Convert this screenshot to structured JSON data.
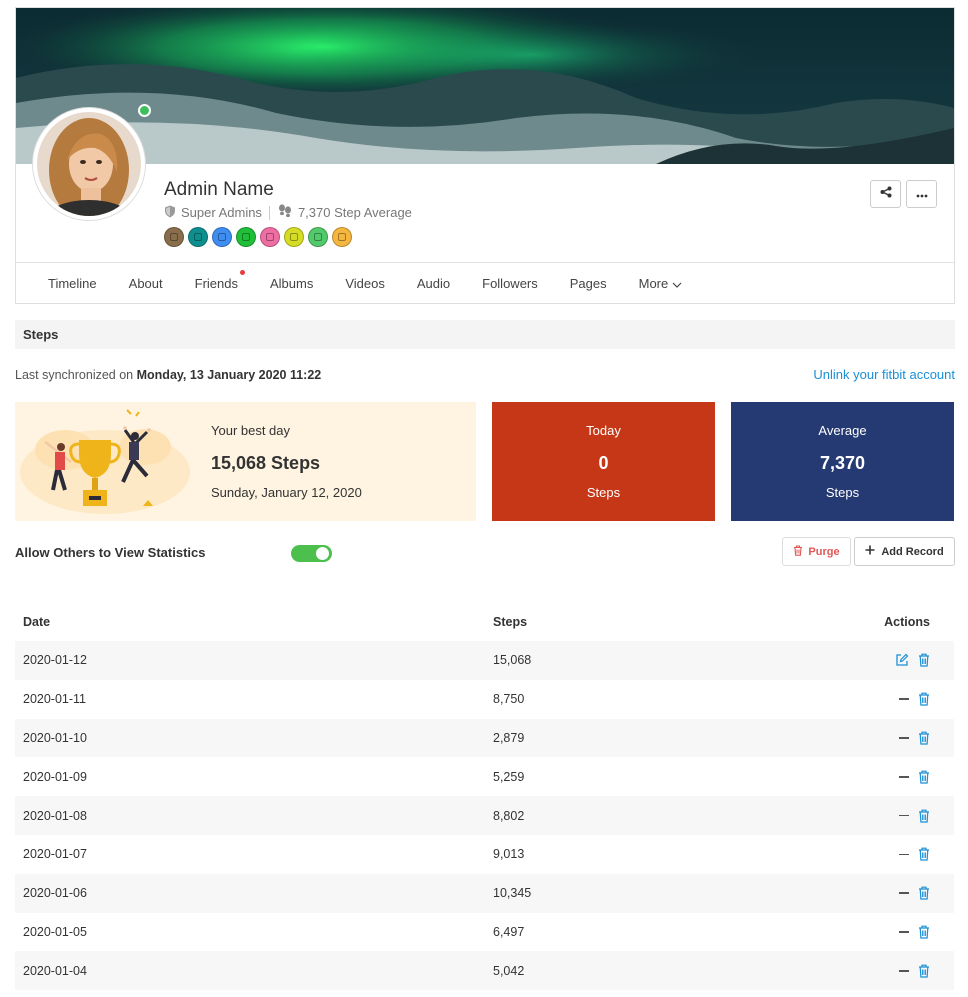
{
  "profile": {
    "name": "Admin Name",
    "role": "Super Admins",
    "step_average": "7,370 Step Average",
    "badges": [
      {
        "name": "badge-1",
        "color": "#8a6e4b"
      },
      {
        "name": "badge-2",
        "color": "#0e8f8f"
      },
      {
        "name": "badge-3",
        "color": "#3d8ef0"
      },
      {
        "name": "badge-4",
        "color": "#1fbf3a"
      },
      {
        "name": "badge-5",
        "color": "#ee6da3"
      },
      {
        "name": "badge-6",
        "color": "#d6dc24"
      },
      {
        "name": "badge-7",
        "color": "#52c96a"
      },
      {
        "name": "badge-8",
        "color": "#f4b63e"
      }
    ],
    "online_color": "#3cbf5c"
  },
  "tabs": [
    {
      "label": "Timeline",
      "icon": "",
      "dot": false
    },
    {
      "label": "About",
      "icon": "",
      "dot": false
    },
    {
      "label": "Friends",
      "icon": "",
      "dot": true
    },
    {
      "label": "Albums",
      "icon": "",
      "dot": false
    },
    {
      "label": "Videos",
      "icon": "",
      "dot": false
    },
    {
      "label": "Audio",
      "icon": "",
      "dot": false
    },
    {
      "label": "Followers",
      "icon": "",
      "dot": false
    },
    {
      "label": "Pages",
      "icon": "",
      "dot": false
    },
    {
      "label": "More",
      "icon": "chevron-down-icon",
      "dot": false
    }
  ],
  "steps": {
    "title": "Steps",
    "sync_prefix": "Last synchronized on",
    "sync_date": "Monday, 13 January 2020 11:22",
    "unlink_label": "Unlink your fitbit account",
    "best": {
      "label": "Your best day",
      "value": "15,068 Steps",
      "date": "Sunday, January 12, 2020"
    },
    "today": {
      "label": "Today",
      "value": "0",
      "unit": "Steps",
      "color": "#c63717"
    },
    "average": {
      "label": "Average",
      "value": "7,370",
      "unit": "Steps",
      "color": "#253a73"
    },
    "allow_label": "Allow Others to View Statistics",
    "allow_enabled": true,
    "purge_label": "Purge",
    "add_label": "Add Record"
  },
  "table": {
    "headers": {
      "date": "Date",
      "steps": "Steps",
      "actions": "Actions"
    },
    "rows": [
      {
        "date": "2020-01-12",
        "steps": "15,068",
        "editable": true
      },
      {
        "date": "2020-01-11",
        "steps": "8,750",
        "editable": false
      },
      {
        "date": "2020-01-10",
        "steps": "2,879",
        "editable": false
      },
      {
        "date": "2020-01-09",
        "steps": "5,259",
        "editable": false
      },
      {
        "date": "2020-01-08",
        "steps": "8,802",
        "editable": false
      },
      {
        "date": "2020-01-07",
        "steps": "9,013",
        "editable": false
      },
      {
        "date": "2020-01-06",
        "steps": "10,345",
        "editable": false
      },
      {
        "date": "2020-01-05",
        "steps": "6,497",
        "editable": false
      },
      {
        "date": "2020-01-04",
        "steps": "5,042",
        "editable": false
      }
    ]
  },
  "colors": {
    "accent": "#1a8fd6",
    "danger": "#e05757",
    "toggle_on": "#4cbf4c"
  }
}
